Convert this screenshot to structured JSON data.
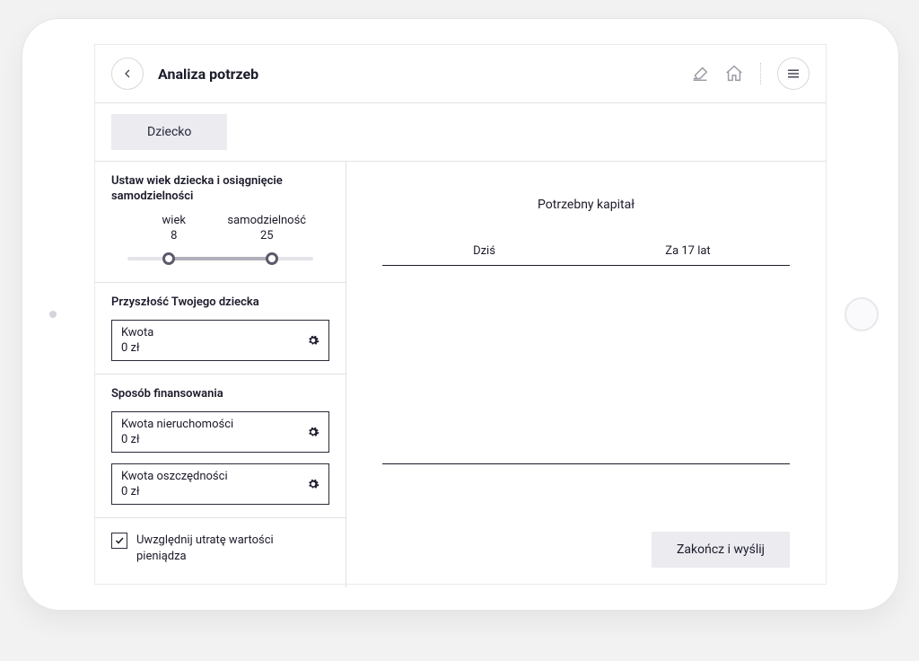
{
  "header": {
    "title": "Analiza potrzeb"
  },
  "tab": {
    "label": "Dziecko"
  },
  "age_slider": {
    "title": "Ustaw wiek dziecka i osiągnięcie samodzielności",
    "label_left": "wiek",
    "label_right": "samodzielność",
    "value_left": "8",
    "value_right": "25"
  },
  "future": {
    "title": "Przyszłość Twojego dziecka",
    "amount_label": "Kwota",
    "amount_value": "0 zł"
  },
  "financing": {
    "title": "Sposób finansowania",
    "realestate_label": "Kwota nieruchomości",
    "realestate_value": "0 zł",
    "savings_label": "Kwota oszczędności",
    "savings_value": "0 zł"
  },
  "inflation_checkbox": {
    "label": "Uwzględnij utratę wartości pieniądza",
    "checked": true
  },
  "right": {
    "capital_title": "Potrzebny kapitał",
    "tab_today": "Dziś",
    "tab_future": "Za 17 lat",
    "finish_label": "Zakończ i wyślij"
  },
  "chart_data": {
    "type": "bar",
    "categories": [
      "Dziś",
      "Za 17 lat"
    ],
    "values": [
      0,
      0
    ],
    "title": "Potrzebny kapitał",
    "xlabel": "",
    "ylabel": "",
    "ylim": [
      0,
      0
    ]
  }
}
